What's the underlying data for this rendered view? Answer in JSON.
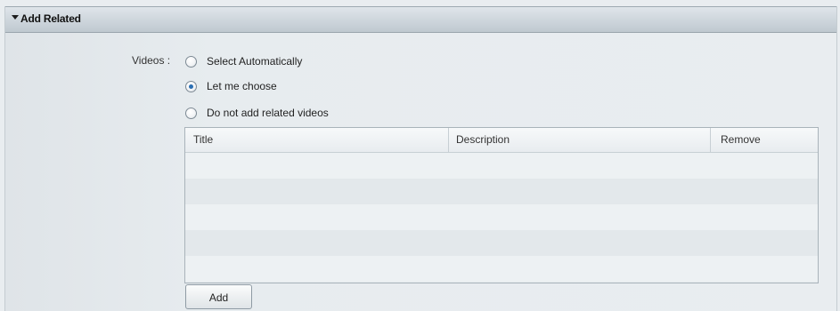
{
  "section": {
    "title": "Add Related",
    "expanded": true
  },
  "videos": {
    "label": "Videos :",
    "options": [
      {
        "label": "Select Automatically",
        "checked": false
      },
      {
        "label": "Let me choose",
        "checked": true
      },
      {
        "label": "Do not add related videos",
        "checked": false
      }
    ]
  },
  "table": {
    "columns": [
      "Title",
      "Description",
      "Remove"
    ],
    "rows": []
  },
  "add_button_label": "Add",
  "colors": {
    "radio_selected": "#2b6fb3",
    "header_bg": "#c9d2d8",
    "panel_bg": "#e9edf0"
  }
}
